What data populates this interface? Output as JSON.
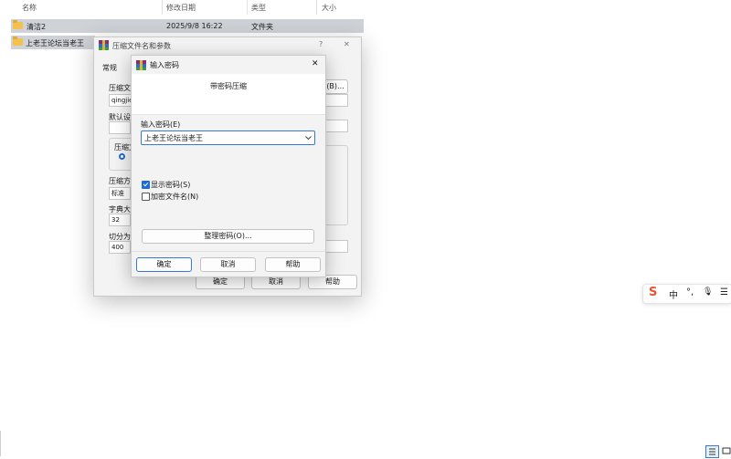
{
  "explorer": {
    "columns": {
      "name": "名称",
      "modified": "修改日期",
      "type": "类型",
      "size": "大小"
    },
    "rows": [
      {
        "name": "清洁2",
        "modified": "2025/9/8 16:22",
        "type": "文件夹"
      },
      {
        "name": "上老王论坛当老王"
      }
    ]
  },
  "back_dialog": {
    "title": "压缩文件名和参数",
    "help_glyph": "?",
    "close_glyph": "✕",
    "tab_general": "常规",
    "label_archive": "压缩文",
    "archive_value": "qingjie",
    "browse_button": "(B)...",
    "label_profile": "默认设",
    "label_format": "压缩文",
    "label_method": "压缩方",
    "method_value": "标准",
    "label_dict": "字典大",
    "dict_value": "32",
    "label_split": "切分为",
    "split_value": "400",
    "ok_button": "确定",
    "cancel_button": "取消",
    "help_button": "帮助"
  },
  "front_dialog": {
    "title": "输入密码",
    "close_glyph": "✕",
    "heading": "带密码压缩",
    "password_label": "输入密码(E)",
    "password_value": "上老王论坛当老王",
    "show_password_label": "显示密码(S)",
    "show_password_checked": true,
    "encrypt_names_label": "加密文件名(N)",
    "encrypt_names_checked": false,
    "organize_button": "整理密码(O)...",
    "ok_button": "确定",
    "cancel_button": "取消",
    "help_button": "帮助"
  },
  "ime": {
    "logo": "S",
    "lang": "中",
    "punct": "°,",
    "mic": "🎙",
    "menu": "☰"
  },
  "colors": {
    "accent": "#1f6cd3",
    "folder": "#f2c14e",
    "ime_logo": "#e8542f"
  }
}
